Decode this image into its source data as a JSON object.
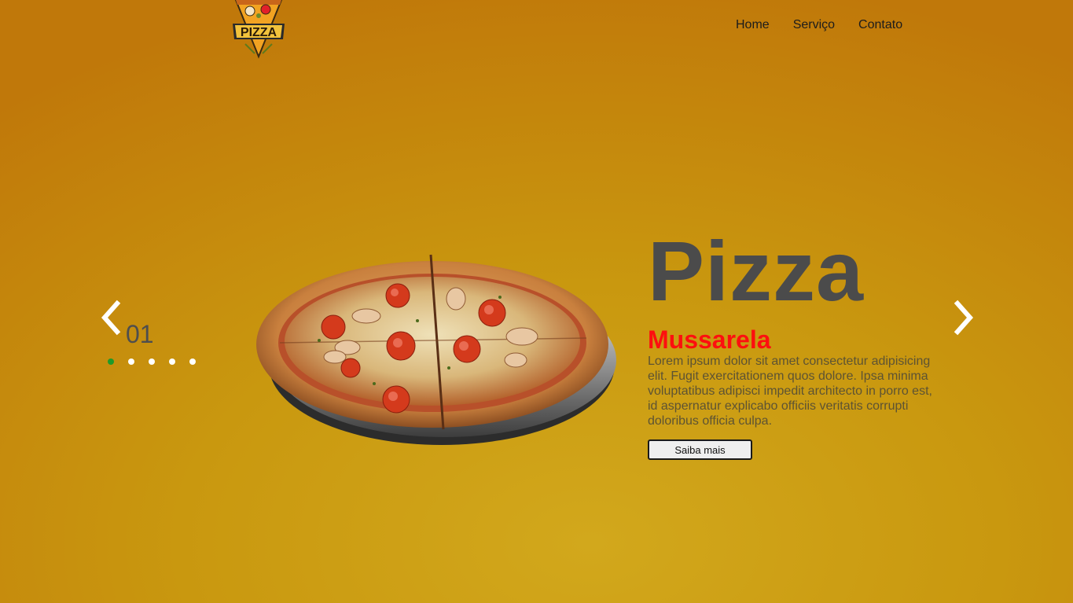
{
  "header": {
    "logo_text": "PIZZA",
    "nav": [
      "Home",
      "Serviço",
      "Contato"
    ]
  },
  "slider": {
    "counter": "01",
    "dots_total": 5,
    "active_dot": 1,
    "prev_icon": "chevron-left-icon",
    "next_icon": "chevron-right-icon"
  },
  "product": {
    "title": "Pizza",
    "name": "Mussarela",
    "description": "Lorem ipsum dolor sit amet consectetur adipisicing elit. Fugit exercitationem quos dolore. Ipsa minima voluptatibus adipisci impedit architecto in porro est, id aspernatur explicabo officiis veritatis corrupti doloribus officia culpa.",
    "button_label": "Saiba mais"
  },
  "colors": {
    "accent_red": "#fd0f0f",
    "title_gray": "#4b4b4b",
    "active_dot": "#1f9a2a",
    "background": "#c9980f"
  }
}
